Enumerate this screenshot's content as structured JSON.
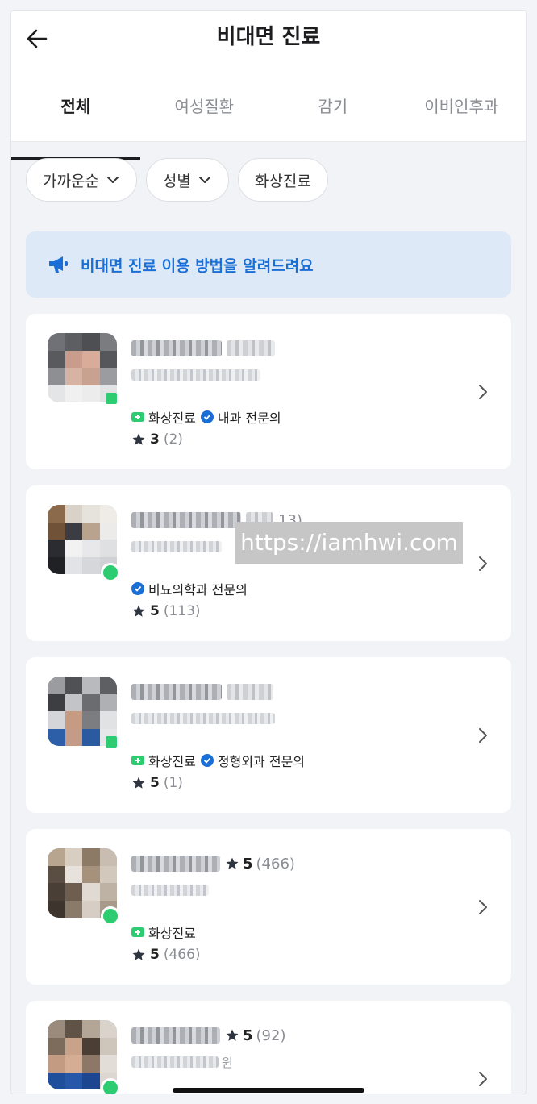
{
  "header": {
    "title": "비대면 진료",
    "back_icon": "arrow-left-icon"
  },
  "tabs": [
    {
      "label": "전체",
      "active": true
    },
    {
      "label": "여성질환",
      "active": false
    },
    {
      "label": "감기",
      "active": false
    },
    {
      "label": "이비인후과",
      "active": false
    }
  ],
  "filters": [
    {
      "label": "가까운순",
      "has_dropdown": true
    },
    {
      "label": "성별",
      "has_dropdown": true
    },
    {
      "label": "화상진료",
      "has_dropdown": false
    }
  ],
  "banner": {
    "text": "비대면 진료 이용 방법을 알려드려요",
    "icon": "megaphone-icon",
    "color": "#1a6fd6"
  },
  "doctors": [
    {
      "name_visible": "",
      "rating_inline": "",
      "tags": [
        {
          "type": "video",
          "label": "화상진료"
        },
        {
          "type": "verified",
          "label": "내과 전문의"
        }
      ],
      "rating": "3",
      "count": "(2)",
      "status": "video"
    },
    {
      "name_visible": "13)",
      "rating_inline": "",
      "tags": [
        {
          "type": "verified",
          "label": "비뇨의학과 전문의"
        }
      ],
      "rating": "5",
      "count": "(113)",
      "status": "online"
    },
    {
      "name_visible": "",
      "rating_inline": "",
      "tags": [
        {
          "type": "video",
          "label": "화상진료"
        },
        {
          "type": "verified",
          "label": "정형외과 전문의"
        }
      ],
      "rating": "5",
      "count": "(1)",
      "status": "video"
    },
    {
      "name_visible": "",
      "rating_inline": "5",
      "rating_inline_count": "(466)",
      "tags": [
        {
          "type": "video",
          "label": "화상진료"
        }
      ],
      "rating": "5",
      "count": "(466)",
      "status": "online"
    },
    {
      "name_visible": "",
      "rating_inline": "5",
      "rating_inline_count": "(92)",
      "sub_suffix": "원",
      "tags": [],
      "rating": "",
      "count": "",
      "status": "online"
    }
  ],
  "watermark": "https://iamhwi.com",
  "colors": {
    "accent_green": "#2ecc71",
    "accent_blue": "#1a6fd6",
    "banner_bg": "#dde9f7"
  }
}
